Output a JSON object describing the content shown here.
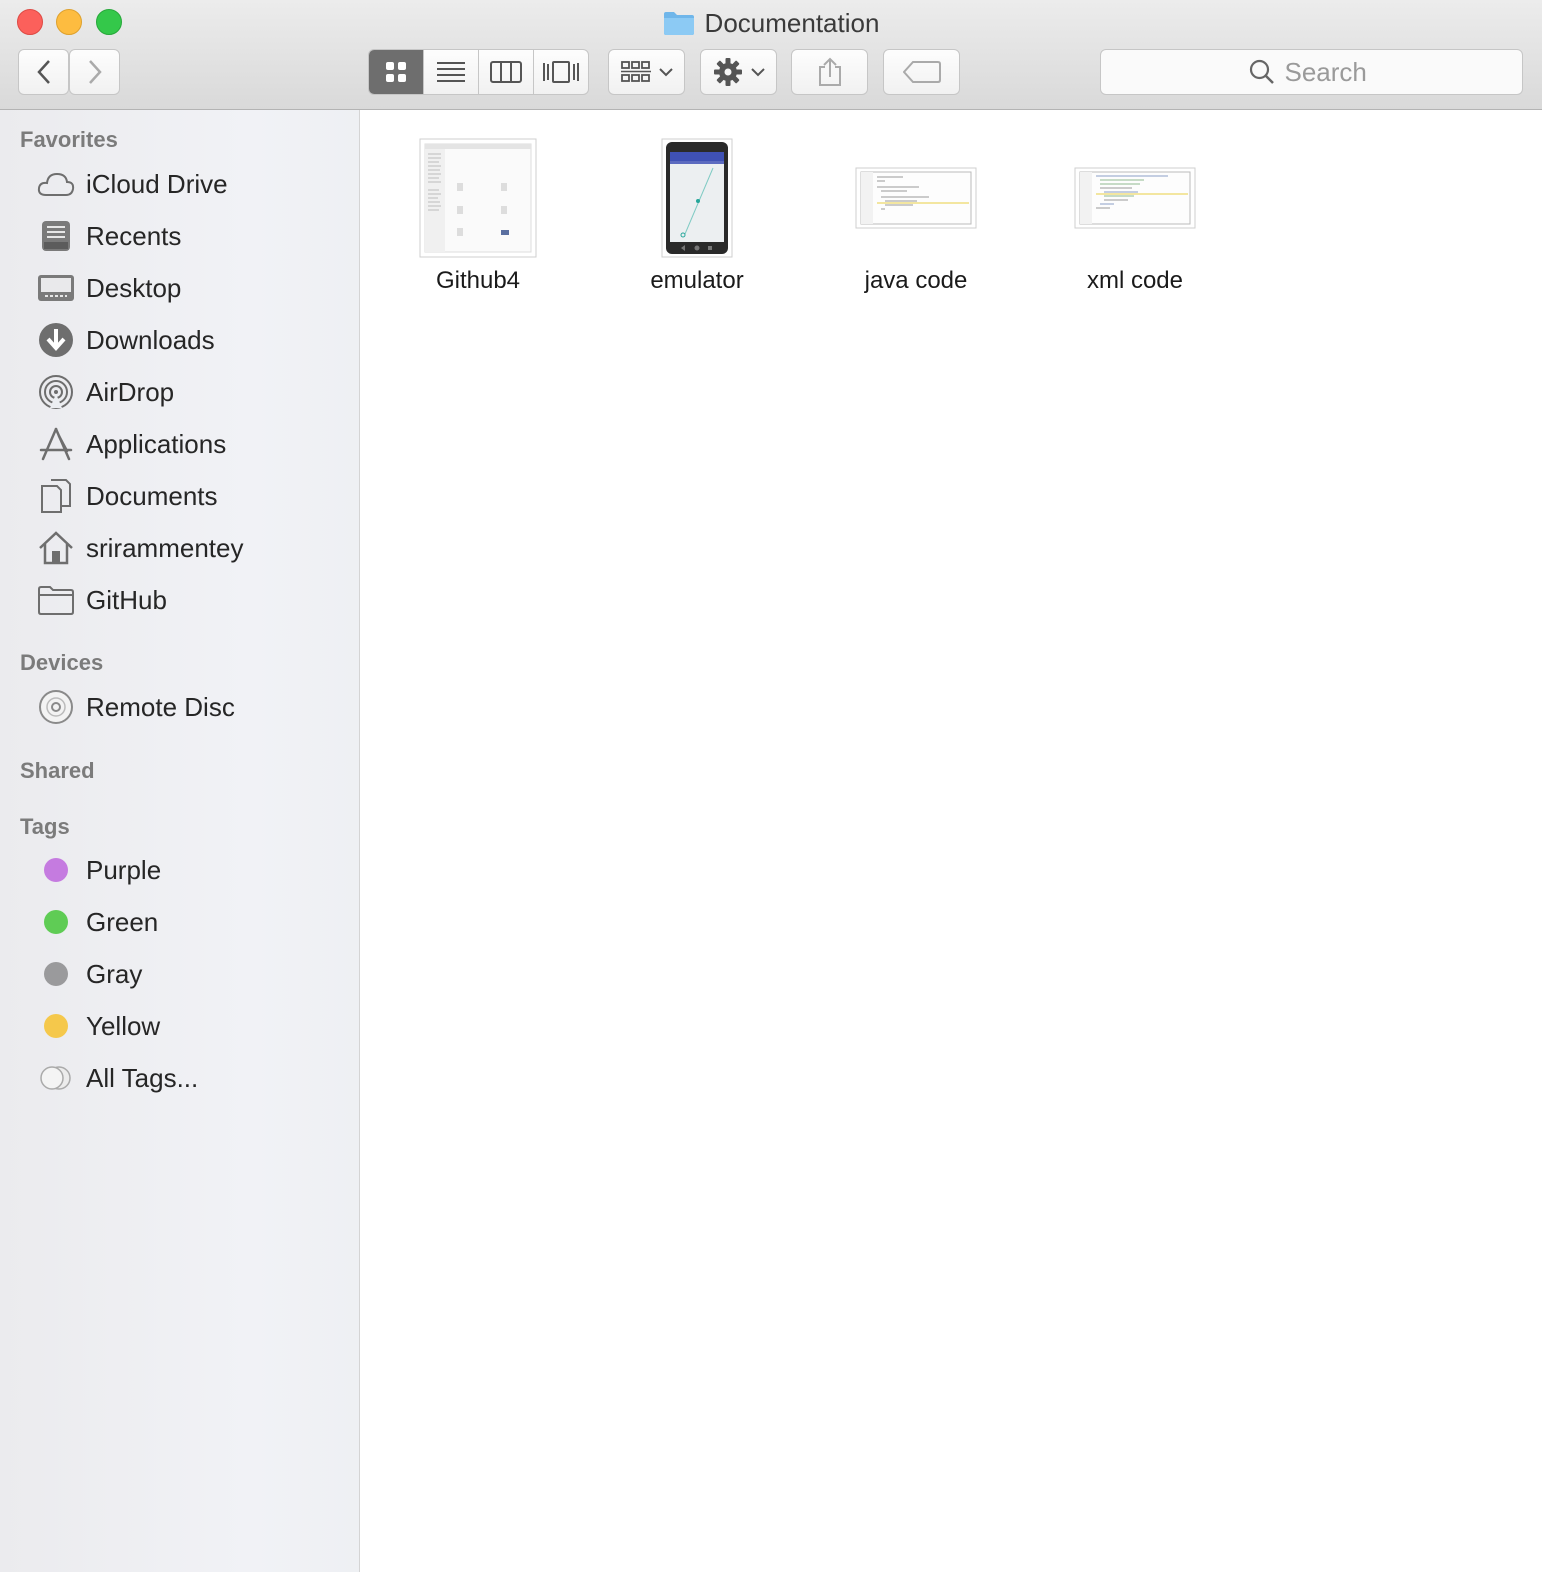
{
  "window": {
    "title": "Documentation"
  },
  "toolbar": {
    "search_placeholder": "Search",
    "view_modes": [
      "icon-view",
      "list-view",
      "column-view",
      "cover-flow-view"
    ],
    "active_view": "icon-view"
  },
  "sidebar": {
    "favorites_heading": "Favorites",
    "favorites": [
      {
        "label": "iCloud Drive",
        "icon": "cloud-icon"
      },
      {
        "label": "Recents",
        "icon": "recents-icon"
      },
      {
        "label": "Desktop",
        "icon": "desktop-icon"
      },
      {
        "label": "Downloads",
        "icon": "downloads-icon"
      },
      {
        "label": "AirDrop",
        "icon": "airdrop-icon"
      },
      {
        "label": "Applications",
        "icon": "applications-icon"
      },
      {
        "label": "Documents",
        "icon": "documents-icon"
      },
      {
        "label": "srirammentey",
        "icon": "home-icon"
      },
      {
        "label": "GitHub",
        "icon": "folder-icon"
      }
    ],
    "devices_heading": "Devices",
    "devices": [
      {
        "label": "Remote Disc",
        "icon": "disc-icon"
      }
    ],
    "shared_heading": "Shared",
    "tags_heading": "Tags",
    "tags": [
      {
        "label": "Purple",
        "color": "#c57be0"
      },
      {
        "label": "Green",
        "color": "#5fcc55"
      },
      {
        "label": "Gray",
        "color": "#9a9a9c"
      },
      {
        "label": "Yellow",
        "color": "#f5c84b"
      },
      {
        "label": "All Tags...",
        "color": "#e5e5e5"
      }
    ]
  },
  "files": [
    {
      "name": "Github4",
      "kind": "screenshot"
    },
    {
      "name": "emulator",
      "kind": "phone-screenshot"
    },
    {
      "name": "java code",
      "kind": "code-screenshot"
    },
    {
      "name": "xml code",
      "kind": "code-screenshot"
    }
  ]
}
